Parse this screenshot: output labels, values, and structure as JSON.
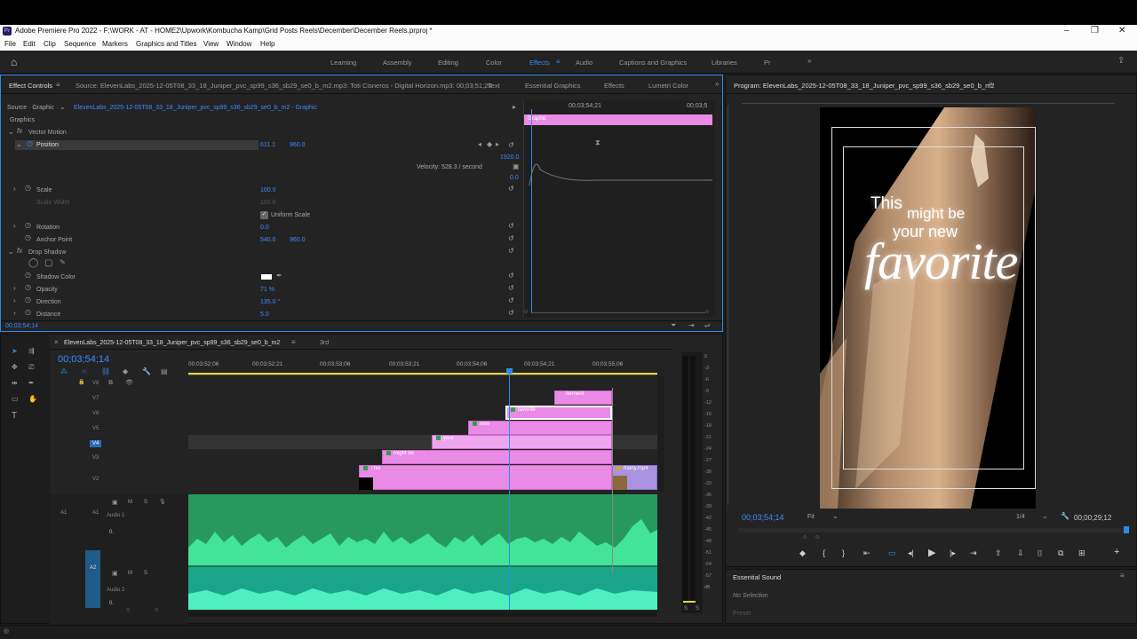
{
  "window": {
    "app_title": "Adobe Premiere Pro 2022 - F:\\WORK - AT - HOME2\\Upwork\\Kombucha Kamp\\Grid Posts Reels\\December\\December Reels.prproj *"
  },
  "menu": [
    "File",
    "Edit",
    "Clip",
    "Sequence",
    "Markers",
    "Graphics and Titles",
    "View",
    "Window",
    "Help"
  ],
  "workspaces": [
    "Learning",
    "Assembly",
    "Editing",
    "Color",
    "Effects",
    "Audio",
    "Captions and Graphics",
    "Libraries",
    "Pr"
  ],
  "active_workspace": "Effects",
  "effect_controls": {
    "tab": "Effect Controls",
    "source_tab": "Source: ElevenLabs_2025-12-05T08_33_18_Juniper_pvc_sp99_s36_sb29_se0_b_m2.mp3: Toti Cisneros - Digital Horizon.mp3: 00;03;51;20",
    "tabs_right": [
      "Text",
      "Essential Graphics",
      "Effects",
      "Lumetri Color"
    ],
    "source_label": "Source · Graphic",
    "clip_path": "ElevenLabs_2025-12-05T08_33_18_Juniper_pvc_sp99_s36_sb29_se0_b_m2 - Graphic",
    "section": "Graphics",
    "vector_motion": "Vector Motion",
    "position_label": "Position",
    "position_x": "611.1",
    "position_y": "960.0",
    "graph_max": "1920.0",
    "graph_min": "0.0",
    "velocity": "Velocity: 528.3 / second",
    "scale_label": "Scale",
    "scale": "100.0",
    "scale_width_label": "Scale Width",
    "scale_width": "100.0",
    "uniform_scale": "Uniform Scale",
    "rotation_label": "Rotation",
    "rotation": "0.0",
    "anchor_label": "Anchor Point",
    "anchor_x": "540.0",
    "anchor_y": "960.0",
    "drop_shadow": "Drop Shadow",
    "shadow_color_label": "Shadow Color",
    "opacity_label": "Opacity",
    "opacity": "71 %",
    "direction_label": "Direction",
    "direction": "135.0 °",
    "distance_label": "Distance",
    "distance": "5.0",
    "timecode": "00;03;54;14",
    "mini_time": "00;03;54;21",
    "mini_time2": "00;03;5",
    "mini_clip": "Graphic"
  },
  "program": {
    "title": "Program: ElevenLabs_2025-12-05T08_33_18_Juniper_pvc_sp99_s36_sb29_se0_b_m2",
    "text_this": "This",
    "text_might": "might be",
    "text_your": "your new",
    "text_favorite": "favorite",
    "timecode": "00;03;54;14",
    "fit": "Fit",
    "quality": "1/4",
    "duration": "00;00;29;12"
  },
  "essential_sound": {
    "title": "Essential Sound",
    "selection": "No Selection",
    "preset": "Preset"
  },
  "timeline": {
    "tab": "ElevenLabs_2025-12-05T08_33_18_Juniper_pvc_sp99_s36_sb29_se0_b_m2",
    "tab2": "3rd",
    "timecode": "00;03;54;14",
    "ruler": [
      "00;03;52;06",
      "00;03;52;21",
      "00;03;53;06",
      "00;03;53;21",
      "00;03;54;06",
      "00;03;54;21",
      "00;03;55;06"
    ],
    "video_tracks": [
      "V8",
      "V7",
      "V6",
      "V5",
      "V4",
      "V3",
      "V2"
    ],
    "audio_tracks": [
      {
        "id": "A1",
        "name": "Audio 1"
      },
      {
        "id": "A2",
        "name": "Audio 2"
      }
    ],
    "audio_level": "0.",
    "clips": [
      {
        "label": "ferment",
        "track": "V8"
      },
      {
        "label": "favorite",
        "track": "V7"
      },
      {
        "label": "new",
        "track": "V6"
      },
      {
        "label": "your",
        "track": "V5"
      },
      {
        "label": "might be",
        "track": "V4"
      },
      {
        "label": "This",
        "track": "V3"
      },
      {
        "label": "many.mp4",
        "track": "V2"
      }
    ],
    "meter_scale": [
      "0",
      "-3",
      "-6",
      "-9",
      "-12",
      "-15",
      "-18",
      "-21",
      "-24",
      "-27",
      "-30",
      "-33",
      "-36",
      "-39",
      "-42",
      "-45",
      "-48",
      "-51",
      "-54",
      "-57",
      "dB"
    ],
    "meter_solo": [
      "S",
      "S"
    ]
  },
  "colors": {
    "accent": "#2d8ceb",
    "clip_pink": "#e98ae6",
    "audio_green": "#2ec27e",
    "playhead": "#2d8ceb"
  }
}
